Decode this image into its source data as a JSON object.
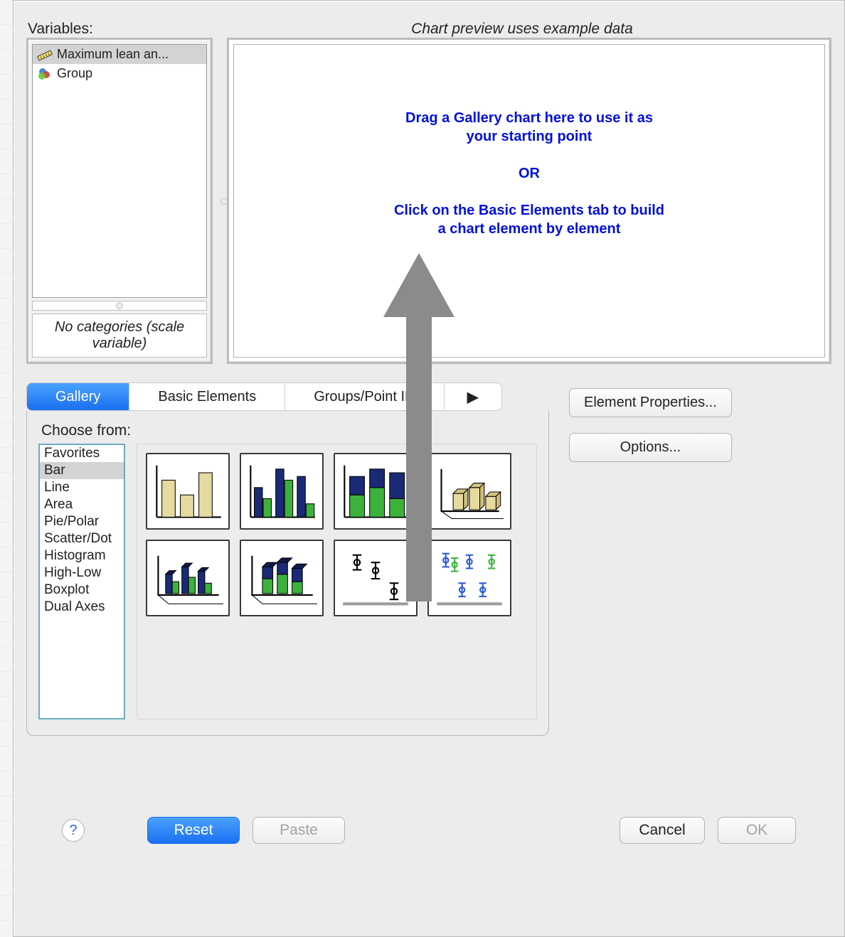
{
  "header": {
    "variables_label": "Variables:",
    "preview_label": "Chart preview uses example data"
  },
  "variables": {
    "items": [
      {
        "label": "Maximum lean an...",
        "icon": "ruler",
        "selected": true
      },
      {
        "label": "Group",
        "icon": "venn",
        "selected": false
      }
    ],
    "footer": "No categories (scale variable)"
  },
  "preview": {
    "line1": "Drag a Gallery chart here to use it as",
    "line2": "your starting point",
    "or": "OR",
    "line3": "Click on the Basic Elements tab to build",
    "line4": "a chart element by element"
  },
  "tabs": {
    "items": [
      "Gallery",
      "Basic Elements",
      "Groups/Point ID"
    ],
    "active_index": 0,
    "overflow_glyph": "▶"
  },
  "gallery": {
    "choose_label": "Choose from:",
    "types": [
      "Favorites",
      "Bar",
      "Line",
      "Area",
      "Pie/Polar",
      "Scatter/Dot",
      "Histogram",
      "High-Low",
      "Boxplot",
      "Dual Axes"
    ],
    "selected_type_index": 1,
    "thumbnails": [
      "bar-simple",
      "bar-clustered",
      "bar-stacked",
      "bar-3d",
      "bar-3d-clustered",
      "bar-3d-stacked",
      "error-bar",
      "error-bar-grouped"
    ]
  },
  "side_buttons": {
    "element_properties": "Element Properties...",
    "options": "Options..."
  },
  "bottom": {
    "help": "?",
    "reset": "Reset",
    "paste": "Paste",
    "cancel": "Cancel",
    "ok": "OK"
  }
}
